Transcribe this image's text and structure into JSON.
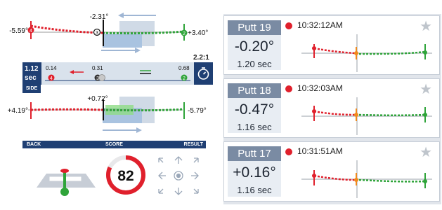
{
  "top_putter": {
    "left_angle": "-5.59°",
    "center_angle": "-2.31°",
    "right_angle": "+3.40°",
    "left_marker": "4",
    "center_marker": "3",
    "right_marker": "2"
  },
  "timeline": {
    "time_value": "1.12",
    "time_unit": "sec",
    "ratio": "2.2:1",
    "mark_left": "0.14",
    "mark_center": "0.31",
    "mark_right": "0.68",
    "marker_left": "4",
    "marker_center": "3",
    "marker_right": "2"
  },
  "side_label": "SIDE",
  "side_putter": {
    "left_angle": "+4.19°",
    "center_angle": "+0.72°",
    "right_angle": "-5.79°"
  },
  "nav": {
    "back": "BACK",
    "score": "SCORE",
    "result": "RESULT"
  },
  "score": {
    "value": "82",
    "fraction": 0.82,
    "color": "#e0202c"
  },
  "colors": {
    "navy": "#1f3f73",
    "red": "#e0202c",
    "green": "#2fa43a",
    "orange": "#f08a1c"
  },
  "putts": [
    {
      "title": "Putt 19",
      "time": "10:32:12AM",
      "angle": "-0.20°",
      "duration": "1.20 sec"
    },
    {
      "title": "Putt 18",
      "time": "10:32:03AM",
      "angle": "-0.47°",
      "duration": "1.16 sec"
    },
    {
      "title": "Putt 17",
      "time": "10:31:51AM",
      "angle": "+0.16°",
      "duration": "1.16 sec"
    }
  ]
}
